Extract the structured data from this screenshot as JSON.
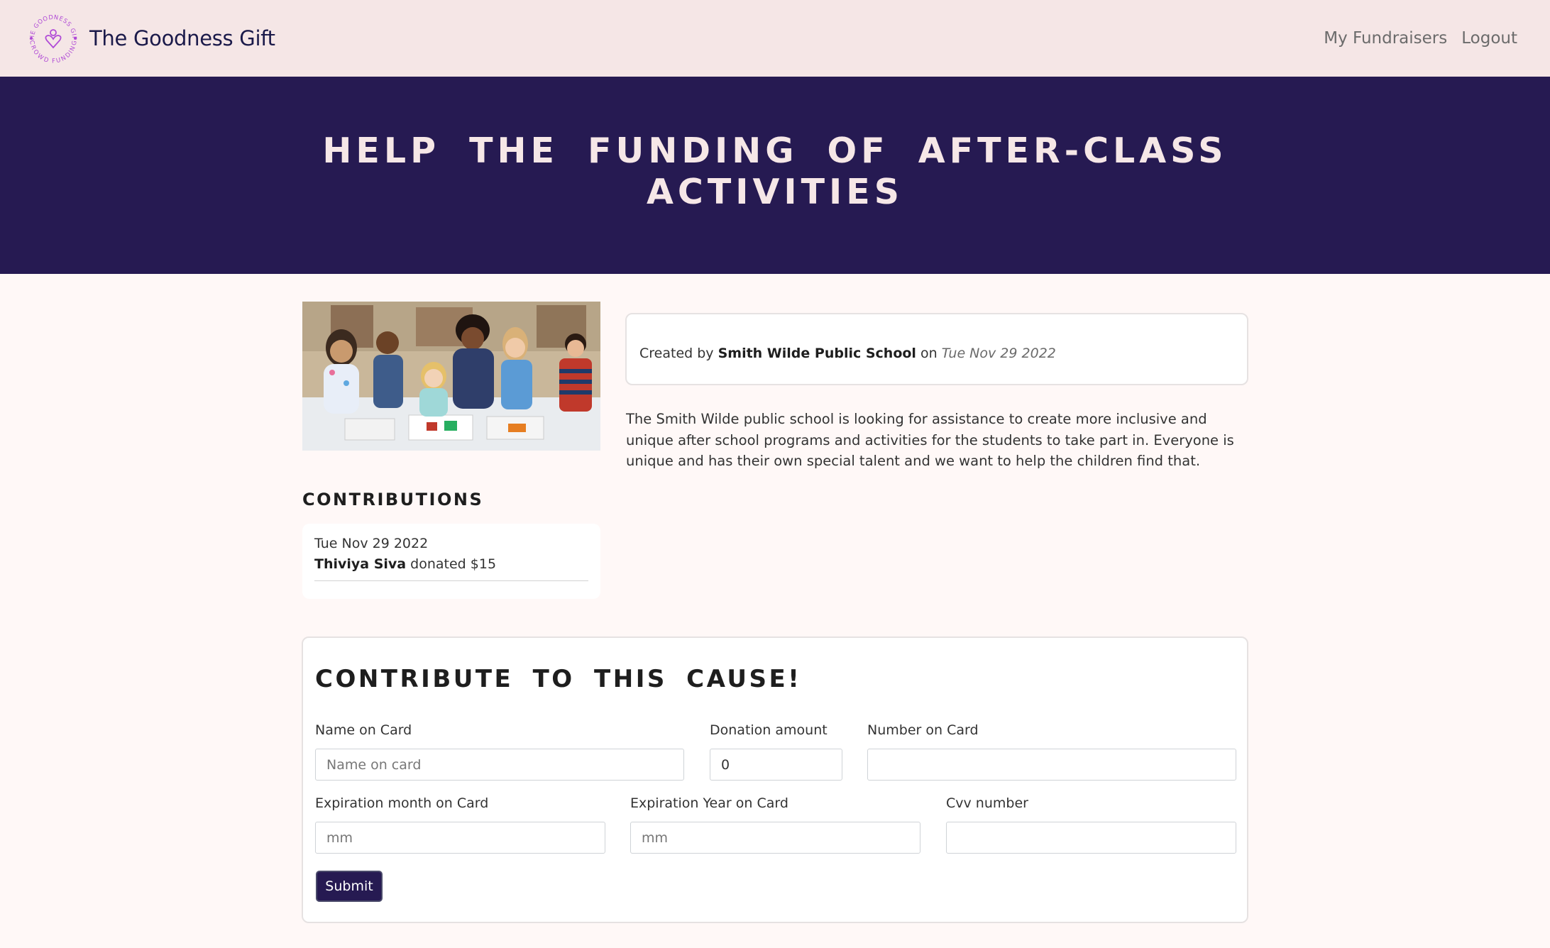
{
  "navbar": {
    "brand_name": "The Goodness Gift",
    "logo_text_top": "THE GOODNESS GIFT",
    "logo_text_bottom": "CROWD FUNDING",
    "links": [
      "My Fundraisers",
      "Logout"
    ]
  },
  "hero": {
    "title": "Help the funding of after-class activities"
  },
  "fundraiser": {
    "image_alt": "children-and-teacher-in-classroom",
    "created_prefix": "Created by",
    "creator": "Smith Wilde Public School",
    "created_on_word": "on",
    "created_date": "Tue Nov 29 2022",
    "description": "The Smith Wilde public school is looking for assistance to create more inclusive and unique after school programs and activities for the students to take part in. Everyone is unique and has their own special talent and we want to help the children find that."
  },
  "contributions": {
    "heading": "Contributions",
    "items": [
      {
        "date": "Tue Nov 29 2022",
        "donor": "Thiviya Siva",
        "text": "donated $15"
      }
    ]
  },
  "form": {
    "title": "Contribute to this cause!",
    "name_label": "Name on Card",
    "name_placeholder": "Name on card",
    "name_value": "",
    "amount_label": "Donation amount",
    "amount_value": "0",
    "number_label": "Number on Card",
    "number_value": "",
    "exp_month_label": "Expiration month on Card",
    "exp_month_placeholder": "mm",
    "exp_year_label": "Expiration Year on Card",
    "exp_year_placeholder": "mm",
    "cvv_label": "Cvv number",
    "cvv_value": "",
    "submit_label": "Submit"
  },
  "colors": {
    "navbar_bg": "#f5e6e6",
    "hero_bg": "#261a52",
    "hero_text": "#f6e7e7",
    "page_bg": "#fff8f7",
    "accent_purple": "#b04ad6",
    "brand_text": "#1b1a4a"
  }
}
